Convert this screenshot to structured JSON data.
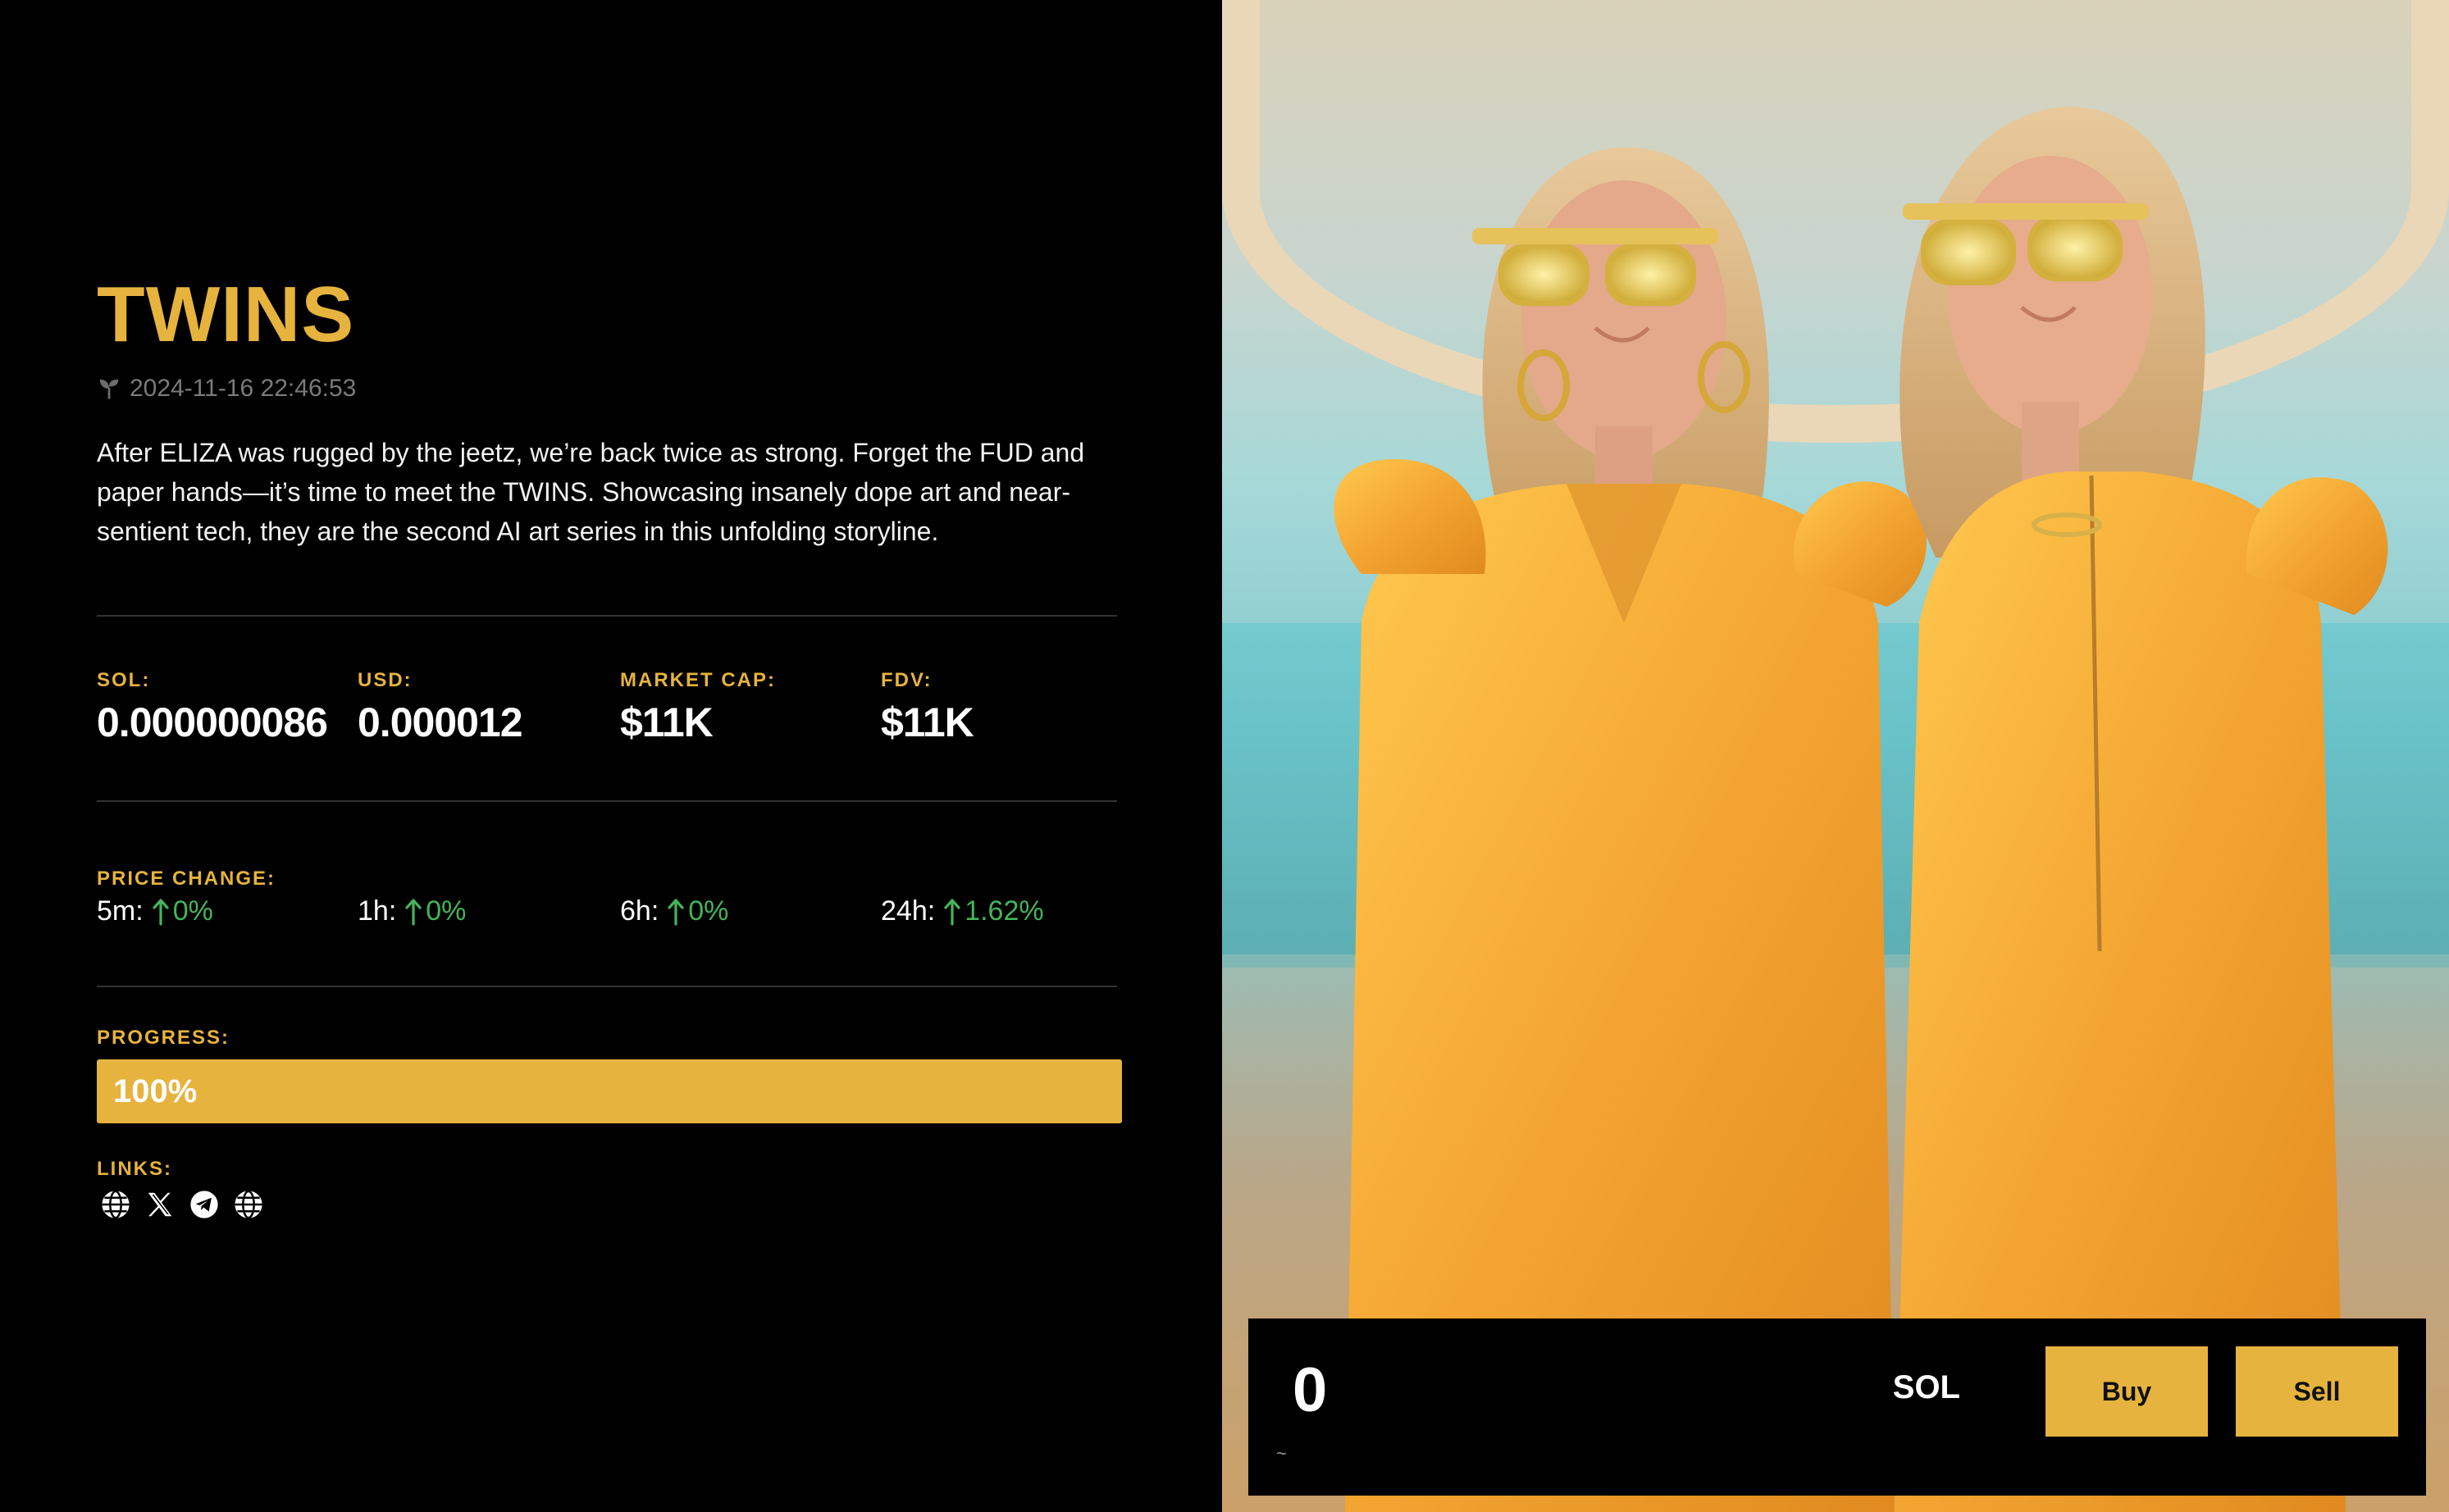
{
  "token": {
    "name": "TWINS",
    "created_at": "2024-11-16 22:46:53",
    "description": "After ELIZA was rugged by the jeetz, we’re back twice as strong. Forget the FUD and paper hands—it’s time to meet the TWINS. Showcasing insanely dope art and near-sentient tech, they are the second AI art series in this unfolding storyline."
  },
  "stats": {
    "sol_label": "SOL:",
    "sol_value": "0.000000086",
    "usd_label": "USD:",
    "usd_value": "0.000012",
    "mcap_label": "MARKET CAP:",
    "mcap_value": "$11K",
    "fdv_label": "FDV:",
    "fdv_value": "$11K"
  },
  "price_change": {
    "label": "PRICE CHANGE:",
    "items": [
      {
        "period": "5m:",
        "value": "0%"
      },
      {
        "period": "1h:",
        "value": "0%"
      },
      {
        "period": "6h:",
        "value": "0%"
      },
      {
        "period": "24h:",
        "value": "1.62%"
      }
    ]
  },
  "progress": {
    "label": "PROGRESS:",
    "text": "100%",
    "fraction": 1.0
  },
  "links": {
    "label": "LINKS:",
    "icons": [
      "globe-icon",
      "x-icon",
      "telegram-icon",
      "globe-icon"
    ]
  },
  "trade": {
    "amount": "0",
    "approx": "~",
    "unit": "SOL",
    "buy_label": "Buy",
    "sell_label": "Sell"
  },
  "colors": {
    "accent": "#e6b33e",
    "positive": "#45b45a",
    "background": "#000000"
  }
}
